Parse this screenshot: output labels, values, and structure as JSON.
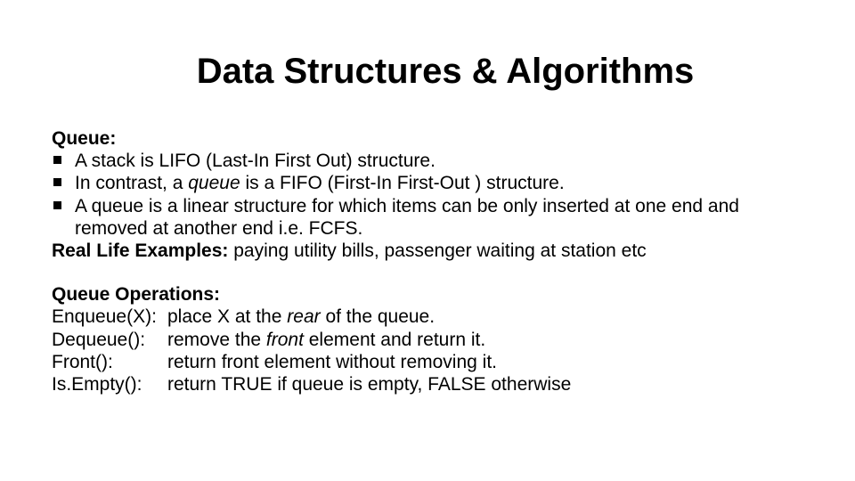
{
  "title": "Data Structures & Algorithms",
  "section1": {
    "heading": "Queue:",
    "bullet1": "A stack is LIFO (Last-In First Out) structure.",
    "bullet2_a": "In contrast, a ",
    "bullet2_b": "queue",
    "bullet2_c": " is a FIFO (First-In First-Out ) structure.",
    "bullet3": "A queue is a linear structure for which items can be only inserted at one end and removed at another end i.e. FCFS.",
    "examples_label": "Real Life Examples: ",
    "examples_text": "paying utility bills, passenger waiting at station etc"
  },
  "section2": {
    "heading": "Queue Operations:",
    "ops": {
      "enqueue_name": "Enqueue(X):",
      "enqueue_a": "place X at the ",
      "enqueue_b": "rear",
      "enqueue_c": " of the queue.",
      "dequeue_name": "Dequeue():",
      "dequeue_a": "remove the ",
      "dequeue_b": "front",
      "dequeue_c": " element and return it.",
      "front_name": "Front():",
      "front_desc": "return front element without removing it.",
      "isempty_name": "Is.Empty():",
      "isempty_desc": "return TRUE if queue is empty, FALSE otherwise"
    }
  }
}
